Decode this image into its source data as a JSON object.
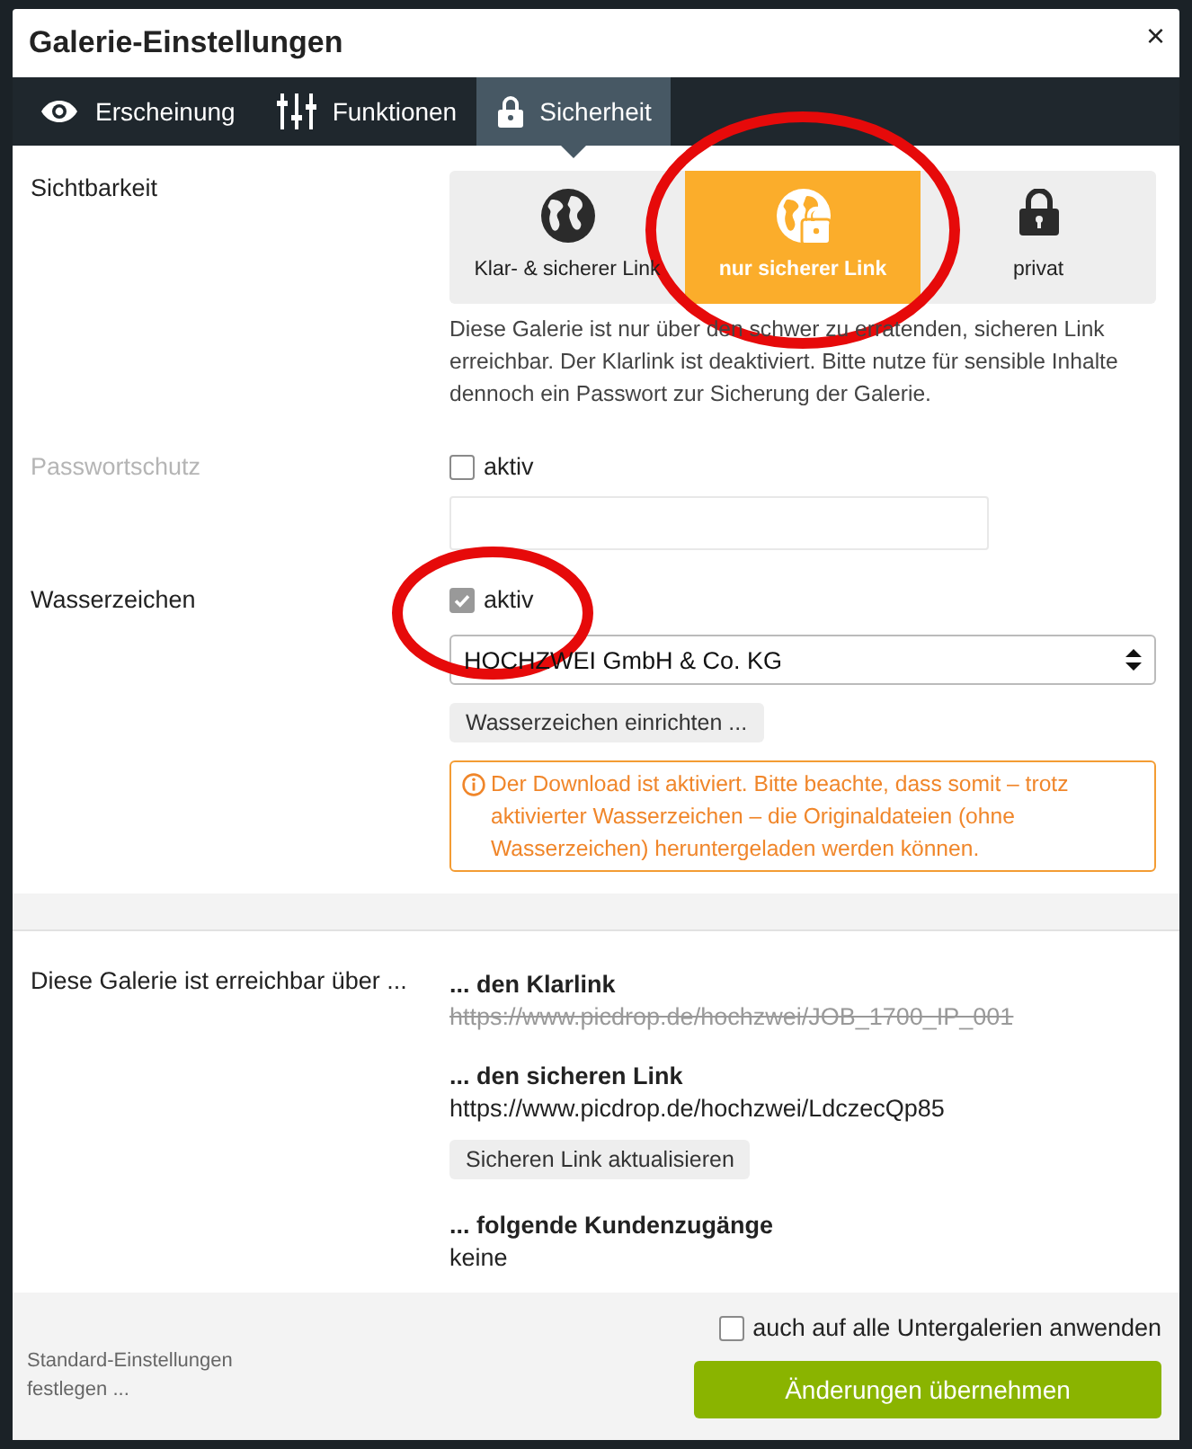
{
  "dialog": {
    "title": "Galerie-Einstellungen",
    "close": "×"
  },
  "tabs": [
    {
      "label": "Erscheinung",
      "selected": false
    },
    {
      "label": "Funktionen",
      "selected": false
    },
    {
      "label": "Sicherheit",
      "selected": true
    }
  ],
  "visibility": {
    "label": "Sichtbarkeit",
    "options": [
      {
        "label": "Klar- & sicherer Link",
        "selected": false,
        "highlighted": false
      },
      {
        "label": "nur sicherer Link",
        "selected": true,
        "highlighted": true
      },
      {
        "label": "privat",
        "selected": false,
        "highlighted": false
      }
    ],
    "description": "Diese Galerie ist nur über den schwer zu erratenden, sicheren Link erreichbar. Der Klarlink ist deaktiviert. Bitte nutze für sensible Inhalte dennoch ein Passwort zur Sicherung der Galerie."
  },
  "password": {
    "label": "Passwortschutz",
    "disabled": true,
    "checkbox": {
      "label": "aktiv",
      "checked": false
    }
  },
  "watermark": {
    "label": "Wasserzeichen",
    "checkbox": {
      "label": "aktiv",
      "checked": true,
      "highlighted": true
    },
    "select": {
      "value": "HOCHZWEI GmbH & Co. KG"
    },
    "button": "Wasserzeichen einrichten ...",
    "warning": "Der Download ist aktiviert. Bitte beachte, dass somit – trotz aktivierter Wasserzeichen – die Originaldateien (ohne Wasserzeichen) heruntergeladen werden können."
  },
  "reach": {
    "label": "Diese Galerie ist erreichbar über ...",
    "items": [
      {
        "heading": "... den Klarlink",
        "value": "https://www.picdrop.de/hochzwei/JOB_1700_IP_001",
        "struck": true
      },
      {
        "heading": "... den sicheren Link",
        "value": "https://www.picdrop.de/hochzwei/LdczecQp85",
        "struck": false,
        "button": "Sicheren Link aktualisieren"
      },
      {
        "heading": "... folgende Kundenzugänge",
        "value": "keine",
        "struck": false
      }
    ]
  },
  "footer": {
    "defaults_link": "Standard-Einstellungen festlegen ...",
    "apply_subgalleries": {
      "label": "auch auf alle Untergalerien anwenden",
      "checked": false
    },
    "submit": "Änderungen übernehmen"
  }
}
